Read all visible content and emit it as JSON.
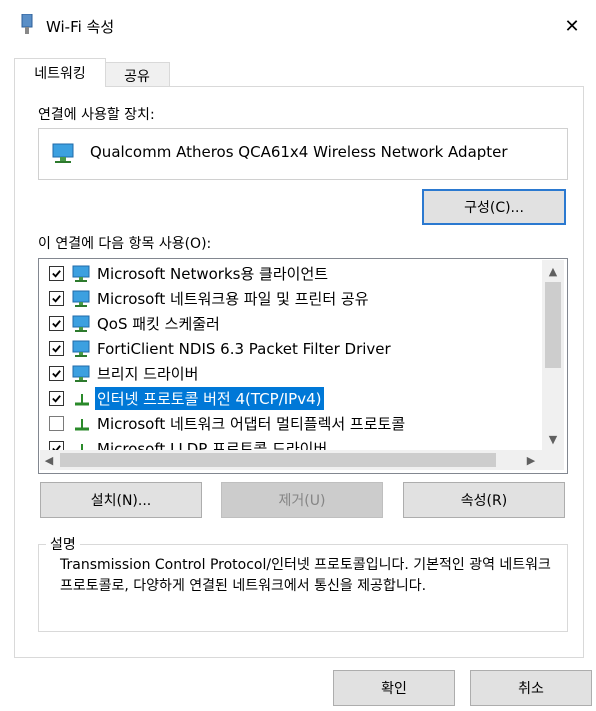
{
  "window": {
    "title": "Wi-Fi 속성",
    "close": "✕"
  },
  "tabs": [
    {
      "label": "네트워킹",
      "active": true
    },
    {
      "label": "공유",
      "active": false
    }
  ],
  "connect_using": {
    "label": "연결에 사용할 장치:",
    "device": "Qualcomm Atheros QCA61x4 Wireless Network Adapter",
    "configure_button": "구성(C)..."
  },
  "items_section": {
    "label": "이 연결에 다음 항목 사용(O):",
    "items": [
      {
        "label": "Microsoft Networks용 클라이언트",
        "checked": true,
        "icon": "network-client-icon"
      },
      {
        "label": "Microsoft 네트워크용 파일 및 프린터 공유",
        "checked": true,
        "icon": "network-share-icon"
      },
      {
        "label": "QoS 패킷 스케줄러",
        "checked": true,
        "icon": "network-service-icon"
      },
      {
        "label": "FortiClient NDIS 6.3 Packet Filter Driver",
        "checked": true,
        "icon": "network-service-icon"
      },
      {
        "label": "브리지 드라이버",
        "checked": true,
        "icon": "network-service-icon"
      },
      {
        "label": "인터넷 프로토콜 버전 4(TCP/IPv4)",
        "checked": true,
        "icon": "protocol-icon",
        "selected": true
      },
      {
        "label": "Microsoft 네트워크 어댑터 멀티플렉서 프로토콜",
        "checked": false,
        "icon": "protocol-icon"
      },
      {
        "label": "Microsoft LLDP 프로토콜 드라이버",
        "checked": true,
        "icon": "protocol-icon"
      }
    ]
  },
  "buttons": {
    "install": "설치(N)...",
    "uninstall": "제거(U)",
    "properties": "속성(R)"
  },
  "description": {
    "title": "설명",
    "text": "Transmission Control Protocol/인터넷 프로토콜입니다. 기본적인 광역 네트워크 프로토콜로, 다양하게 연결된 네트워크에서 통신을 제공합니다."
  },
  "footer": {
    "ok": "확인",
    "cancel": "취소"
  },
  "colors": {
    "selection": "#0078d7",
    "default_button_border": "#2b79d0"
  }
}
